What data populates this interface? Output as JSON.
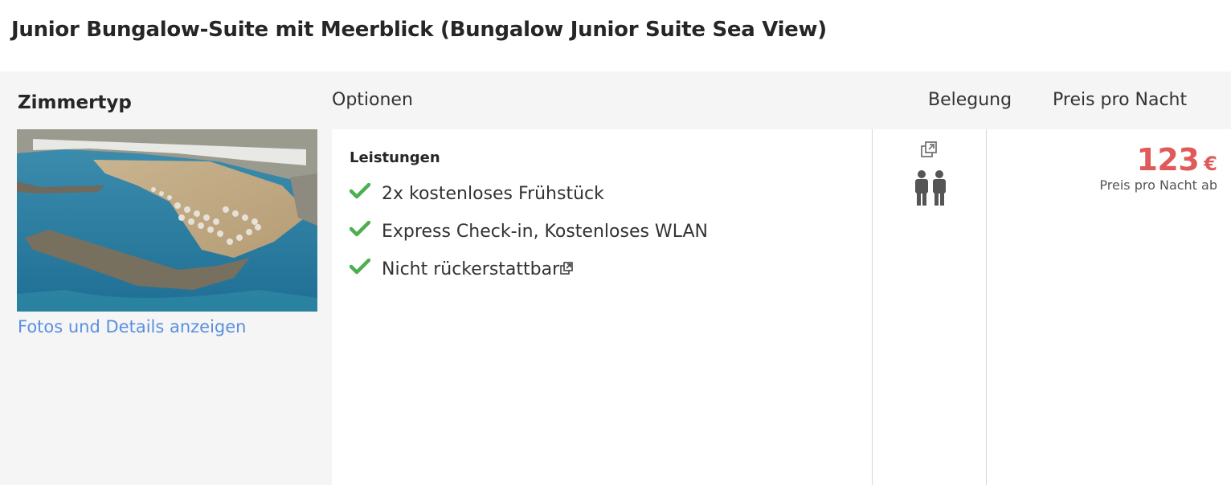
{
  "room_title": "Junior Bungalow-Suite mit Meerblick (Bungalow Junior Suite Sea View)",
  "headers": {
    "room_type": "Zimmertyp",
    "options": "Optionen",
    "occupancy": "Belegung",
    "price_per_night": "Preis pro Nacht"
  },
  "room": {
    "photo_icon": "beach-resort-photo",
    "details_link": "Fotos und Details anzeigen"
  },
  "services": {
    "title": "Leistungen",
    "items": [
      "2x kostenloses Frühstück",
      "Express Check-in, Kostenloses WLAN",
      "Nicht rückerstattbar"
    ]
  },
  "occupancy": {
    "icon": "two-persons-icon",
    "popup_icon": "external-link-icon"
  },
  "price": {
    "amount": "123",
    "currency": "€",
    "label": "Preis pro Nacht ab"
  },
  "colors": {
    "accent_price": "#e05a5a",
    "link": "#5a8fe0",
    "check": "#4caf50",
    "header_bg": "#f5f5f5"
  }
}
